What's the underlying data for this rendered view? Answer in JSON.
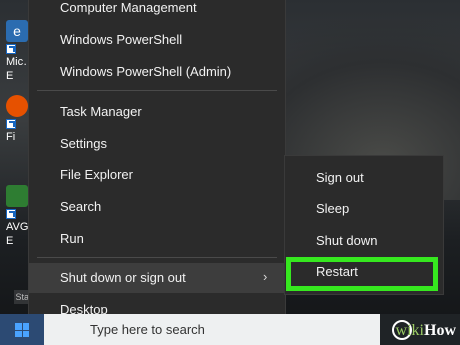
{
  "desktop": {
    "icons": [
      {
        "label": "Mic…",
        "sub": "E",
        "icon": "edge-icon",
        "color": "#2b6cb0"
      },
      {
        "label": "Fi",
        "sub": "",
        "icon": "firefox-icon",
        "color": "#e65100"
      },
      {
        "label": "AVG …",
        "sub": "E",
        "icon": "avg-icon",
        "color": "#2e7d32"
      }
    ]
  },
  "winx_menu": {
    "items": [
      {
        "label": "Computer Management"
      },
      {
        "label": "Windows PowerShell"
      },
      {
        "label": "Windows PowerShell (Admin)"
      },
      {
        "label": "Task Manager"
      },
      {
        "label": "Settings"
      },
      {
        "label": "File Explorer"
      },
      {
        "label": "Search"
      },
      {
        "label": "Run"
      },
      {
        "label": "Shut down or sign out"
      },
      {
        "label": "Desktop"
      }
    ],
    "chevron": "›"
  },
  "shutdown_submenu": {
    "items": [
      {
        "label": "Sign out"
      },
      {
        "label": "Sleep"
      },
      {
        "label": "Shut down"
      },
      {
        "label": "Restart"
      }
    ],
    "highlight_color": "#36e81f"
  },
  "taskbar": {
    "search_placeholder": "Type here to search",
    "start_color": "#2c4a73"
  },
  "watermark": {
    "wiki": "wiki",
    "how": "How"
  },
  "ghost_label": "Start"
}
